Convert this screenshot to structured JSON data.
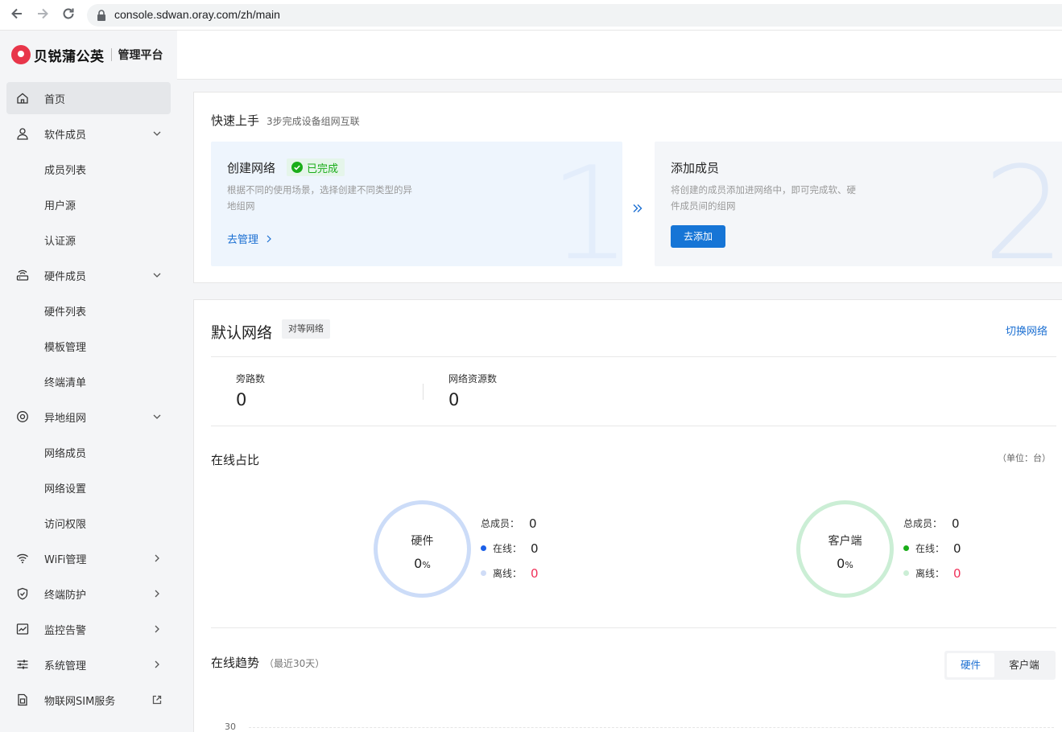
{
  "browser": {
    "url": "console.sdwan.oray.com/zh/main"
  },
  "brand": {
    "name": "贝锐蒲公英",
    "sub": "管理平台",
    "colors": {
      "brand": "#e8364a",
      "accent": "#1675d6"
    }
  },
  "sidebar": {
    "items": [
      {
        "label": "首页",
        "icon": "home-icon",
        "active": true
      },
      {
        "label": "软件成员",
        "icon": "user-icon",
        "arrow": "down"
      },
      {
        "label": "成员列表",
        "sub": true
      },
      {
        "label": "用户源",
        "sub": true
      },
      {
        "label": "认证源",
        "sub": true
      },
      {
        "label": "硬件成员",
        "icon": "router-icon",
        "arrow": "down"
      },
      {
        "label": "硬件列表",
        "sub": true
      },
      {
        "label": "模板管理",
        "sub": true
      },
      {
        "label": "终端清单",
        "sub": true
      },
      {
        "label": "异地组网",
        "icon": "network-icon",
        "arrow": "down"
      },
      {
        "label": "网络成员",
        "sub": true
      },
      {
        "label": "网络设置",
        "sub": true
      },
      {
        "label": "访问权限",
        "sub": true
      },
      {
        "label": "WiFi管理",
        "icon": "wifi-icon",
        "arrow": "right"
      },
      {
        "label": "终端防护",
        "icon": "shield-icon",
        "arrow": "right"
      },
      {
        "label": "监控告警",
        "icon": "monitor-icon",
        "arrow": "right"
      },
      {
        "label": "系统管理",
        "icon": "settings-icon",
        "arrow": "right"
      },
      {
        "label": "物联网SIM服务",
        "icon": "sim-icon",
        "arrow": "external"
      }
    ]
  },
  "quickstart": {
    "title": "快速上手",
    "subtitle": "3步完成设备组网互联",
    "step1": {
      "num": "1",
      "title": "创建网络",
      "badge": "已完成",
      "desc": "根据不同的使用场景，选择创建不同类型的异地组网",
      "link": "去管理"
    },
    "step2": {
      "num": "2",
      "title": "添加成员",
      "desc": "将创建的成员添加进网络中，即可完成软、硬件成员间的组网",
      "button": "去添加"
    }
  },
  "network": {
    "title": "默认网络",
    "tag": "对等网络",
    "switch": "切换网络",
    "stats": [
      {
        "label": "旁路数",
        "value": "0"
      },
      {
        "label": "网络资源数",
        "value": "0"
      }
    ]
  },
  "online_ratio": {
    "title": "在线占比",
    "unit": "（单位：台）",
    "hardware": {
      "label": "硬件",
      "value": "0",
      "pct": "%",
      "total_label": "总成员：",
      "total": "0",
      "online_label": "在线：",
      "online": "0",
      "offline_label": "离线：",
      "offline": "0"
    },
    "client": {
      "label": "客户端",
      "value": "0",
      "pct": "%",
      "total_label": "总成员：",
      "total": "0",
      "online_label": "在线：",
      "online": "0",
      "offline_label": "离线：",
      "offline": "0"
    }
  },
  "trend": {
    "title": "在线趋势",
    "subtitle": "（最近30天）",
    "tabs": [
      "硬件",
      "客户端"
    ],
    "y_tick": "30"
  }
}
